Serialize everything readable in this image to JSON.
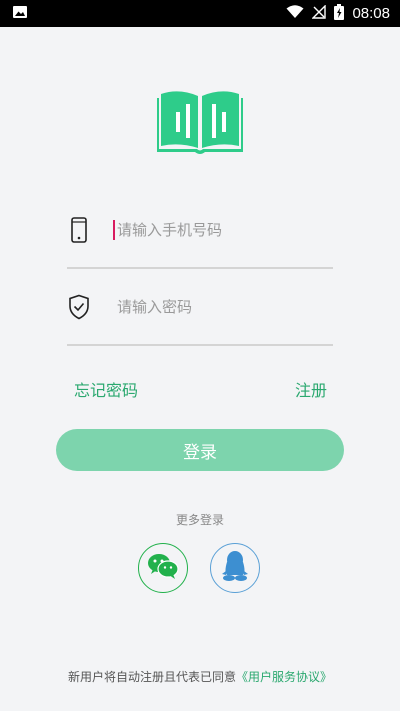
{
  "status_bar": {
    "time": "08:08",
    "icons": [
      "image-icon",
      "wifi-icon",
      "no-signal-icon",
      "battery-charging-icon"
    ]
  },
  "logo": {
    "icon": "open-book-icon",
    "color": "#2ecc8a"
  },
  "form": {
    "phone": {
      "icon": "phone-icon",
      "value": "",
      "placeholder": "请输入手机号码"
    },
    "password": {
      "icon": "shield-check-icon",
      "value": "",
      "placeholder": "请输入密码"
    },
    "forgot_label": "忘记密码",
    "register_label": "注册",
    "login_label": "登录"
  },
  "more_login": {
    "label": "更多登录",
    "options": [
      {
        "name": "wechat-icon",
        "color": "#22b14c"
      },
      {
        "name": "qq-icon",
        "color": "#3d8fd1"
      }
    ]
  },
  "footer": {
    "text": "新用户将自动注册且代表已同意",
    "agreement_label": "《用户服务协议》"
  },
  "colors": {
    "accent": "#2aa86f",
    "login_button": "#7dd4ad",
    "background": "#f3f4f6"
  }
}
